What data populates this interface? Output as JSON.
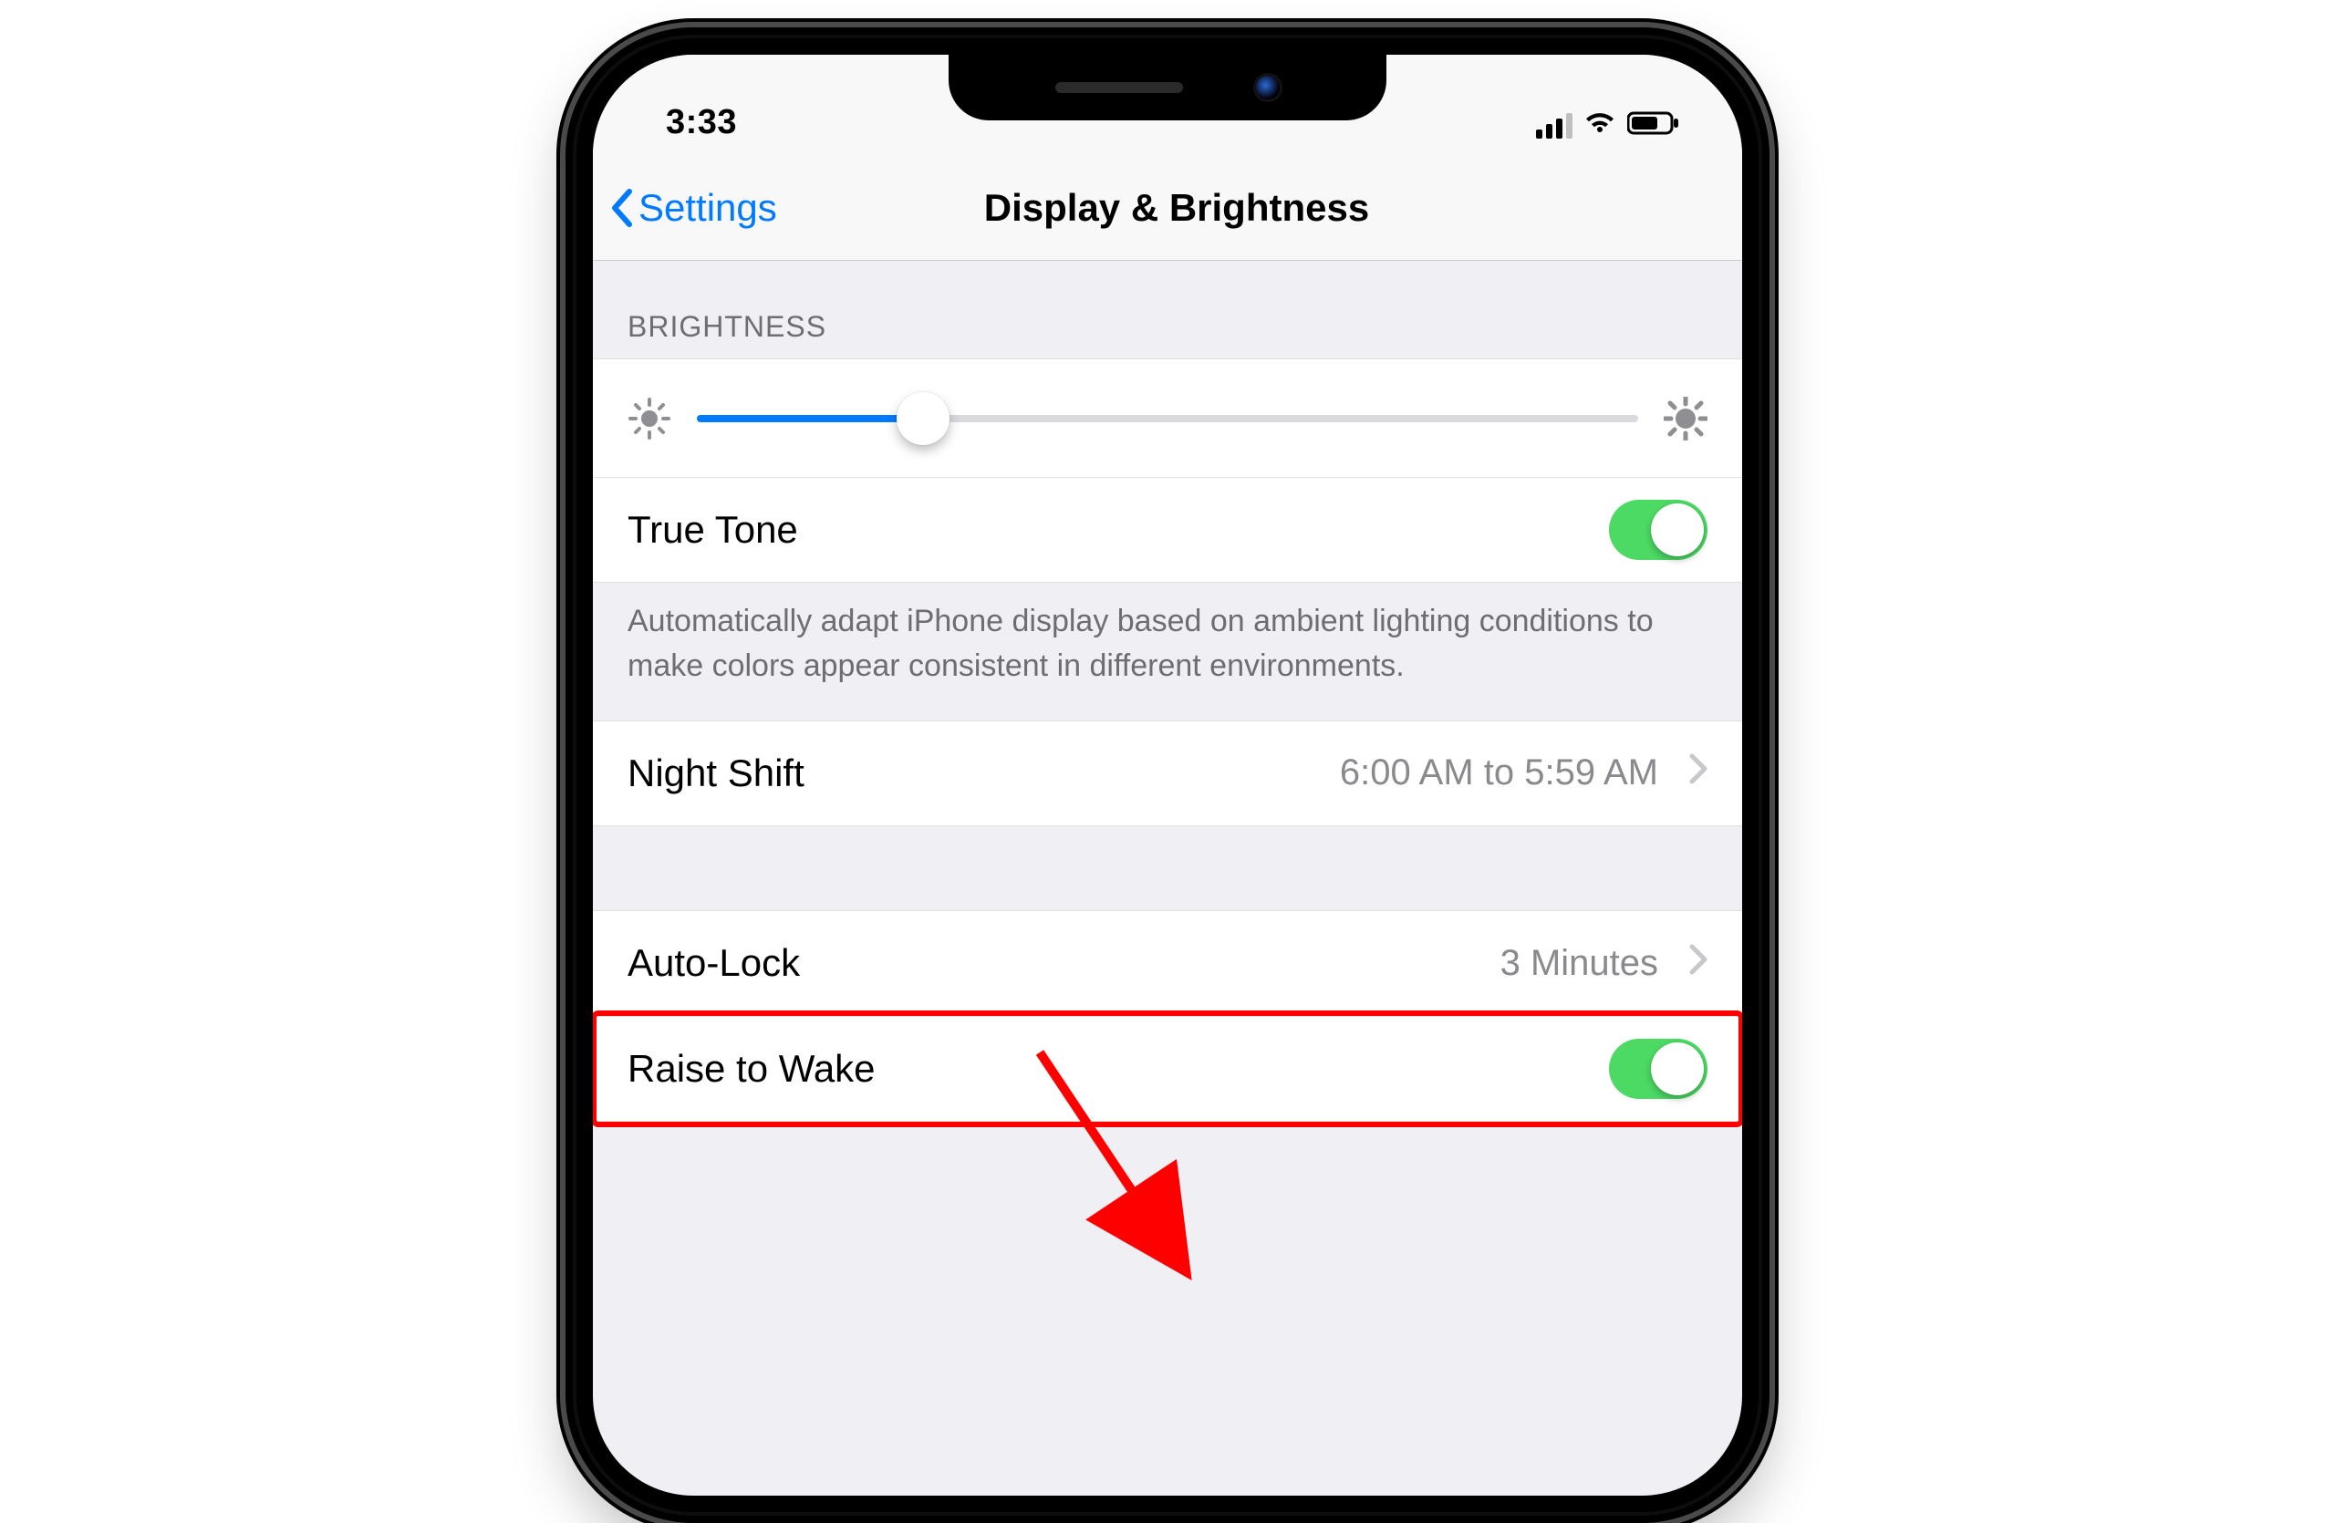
{
  "statusbar": {
    "time": "3:33"
  },
  "navbar": {
    "back_label": "Settings",
    "title": "Display & Brightness"
  },
  "brightness": {
    "header": "BRIGHTNESS",
    "slider_value_pct": 24,
    "true_tone_label": "True Tone",
    "true_tone_on": true,
    "footnote": "Automatically adapt iPhone display based on ambient lighting conditions to make colors appear consistent in different environments."
  },
  "night_shift": {
    "label": "Night Shift",
    "value": "6:00 AM to 5:59 AM"
  },
  "auto_lock": {
    "label": "Auto-Lock",
    "value": "3 Minutes"
  },
  "raise_to_wake": {
    "label": "Raise to Wake",
    "on": true
  }
}
